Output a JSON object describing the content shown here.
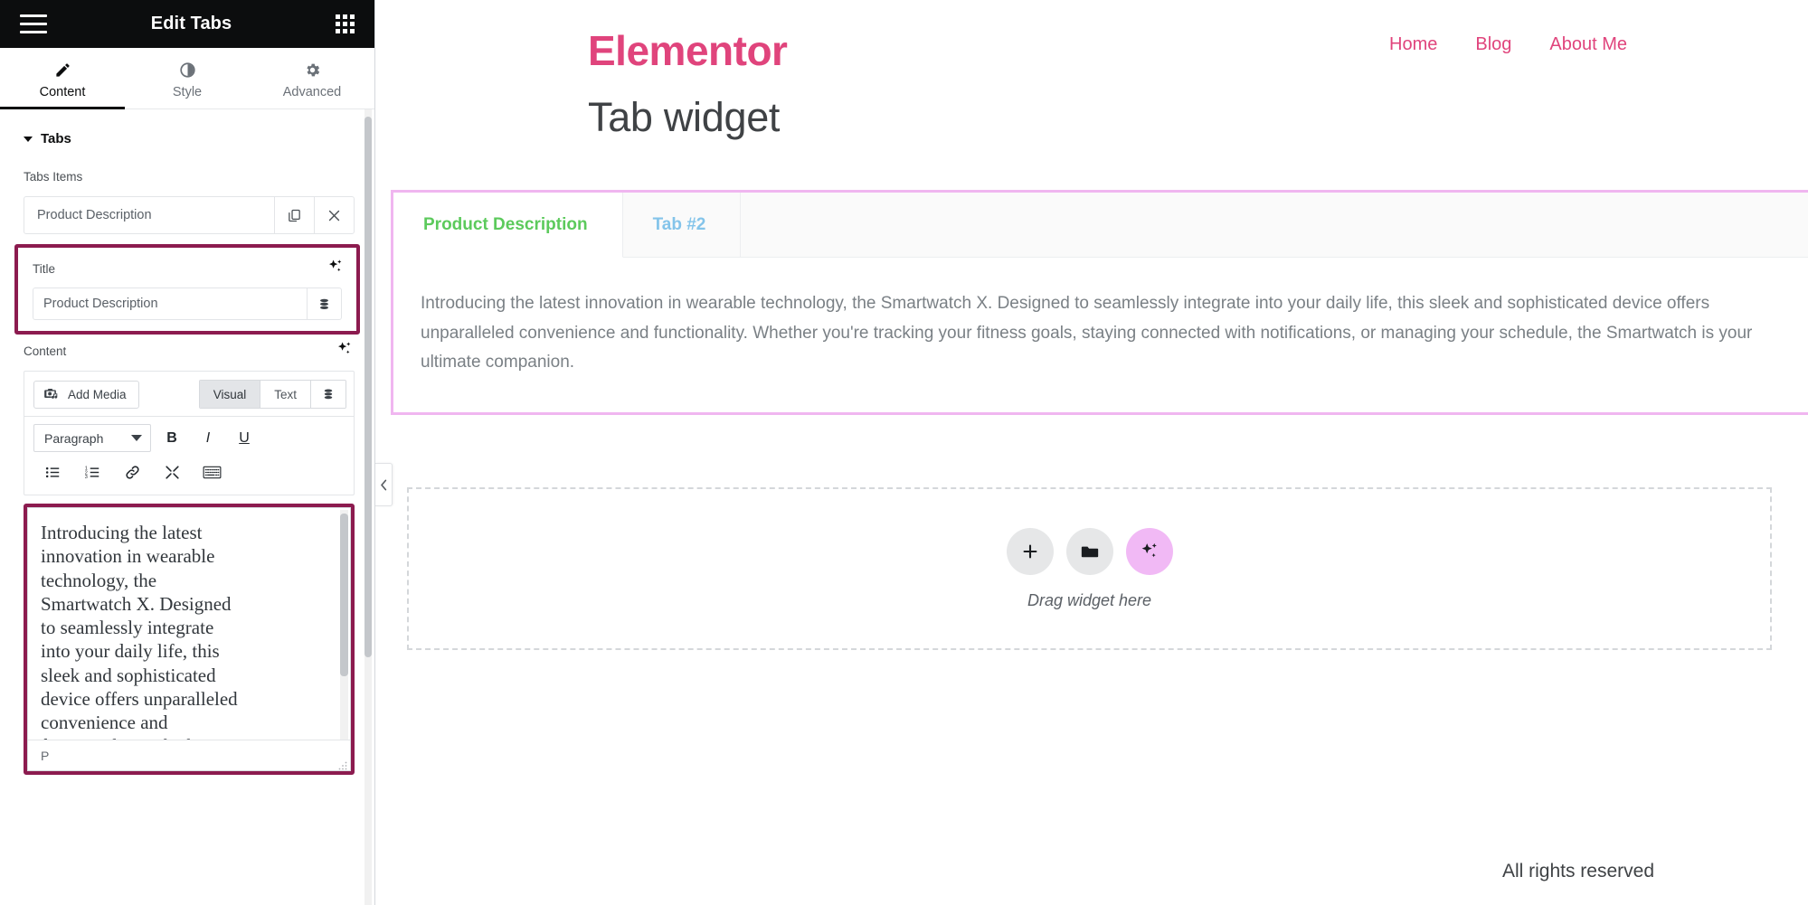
{
  "panel": {
    "header": {
      "title": "Edit Tabs",
      "menu_icon": "hamburger-menu-icon",
      "apps_icon": "grid-apps-icon"
    },
    "tabs": [
      {
        "label": "Content",
        "icon": "pencil-icon",
        "active": true
      },
      {
        "label": "Style",
        "icon": "contrast-half-circle-icon",
        "active": false
      },
      {
        "label": "Advanced",
        "icon": "gear-icon",
        "active": false
      }
    ],
    "section": {
      "title": "Tabs"
    },
    "tabs_items": {
      "label": "Tabs Items",
      "items": [
        {
          "title": "Product Description",
          "duplicate_icon": "copy-icon",
          "remove_icon": "close-x-icon"
        }
      ]
    },
    "title_field": {
      "label": "Title",
      "ai_icon": "ai-sparkle-icon",
      "value": "Product Description",
      "placeholder": "Title",
      "dynamic_icon": "dynamic-tags-stack-icon",
      "highlighted": true
    },
    "content_field": {
      "label": "Content",
      "ai_icon": "ai-sparkle-icon",
      "add_media_label": "Add Media",
      "add_media_icon": "media-camera-music-icon",
      "editor_modes": [
        {
          "label": "Visual",
          "active": true
        },
        {
          "label": "Text",
          "active": false
        }
      ],
      "dynamic_icon": "dynamic-tags-stack-icon",
      "toolbar": {
        "format_select": "Paragraph",
        "buttons": [
          {
            "label": "B",
            "name": "bold-icon"
          },
          {
            "label": "I",
            "name": "italic-icon"
          },
          {
            "label": "U",
            "name": "underline-icon"
          }
        ],
        "row2": [
          {
            "name": "bullet-list-icon"
          },
          {
            "name": "numbered-list-icon"
          },
          {
            "name": "link-icon"
          },
          {
            "name": "fullscreen-expand-icon"
          },
          {
            "name": "toolbar-toggle-keyboard-icon"
          }
        ]
      },
      "body_text": "Introducing the latest innovation in wearable technology, the Smartwatch X. Designed to seamlessly integrate into your daily life, this sleek and sophisticated device offers unparalleled convenience and functionality. Whether you're tracking your fitness",
      "status_path": "P",
      "highlighted": true
    }
  },
  "collapse_handle": {
    "icon": "chevron-left-icon"
  },
  "preview": {
    "brand": "Elementor",
    "nav": [
      {
        "label": "Home"
      },
      {
        "label": "Blog"
      },
      {
        "label": "About Me"
      }
    ],
    "page_title": "Tab widget",
    "tabs_widget": {
      "tabs": [
        {
          "label": "Product Description",
          "active": true
        },
        {
          "label": "Tab #2",
          "active": false
        }
      ],
      "pane_text": "Introducing the latest innovation in wearable technology, the Smartwatch X. Designed to seamlessly integrate into your daily life, this sleek and sophisticated device offers unparalleled convenience and functionality. Whether you're tracking your fitness goals, staying connected with notifications, or managing your schedule, the Smartwatch is your ultimate companion."
    },
    "drop_zone": {
      "label": "Drag widget here",
      "buttons": [
        {
          "name": "add-plus-icon"
        },
        {
          "name": "folder-icon"
        },
        {
          "name": "ai-sparkle-icon"
        }
      ]
    },
    "footer": "All rights reserved"
  },
  "colors": {
    "panel_header_bg": "#0c0d0e",
    "highlight_border": "#8c1b4f",
    "brand_pink": "#e0447c",
    "active_tab_green": "#5cca5c",
    "inactive_tab_blue": "#84c4ea",
    "widget_outline": "#f0b6f0",
    "ai_button_pink": "#f1b9f5"
  }
}
